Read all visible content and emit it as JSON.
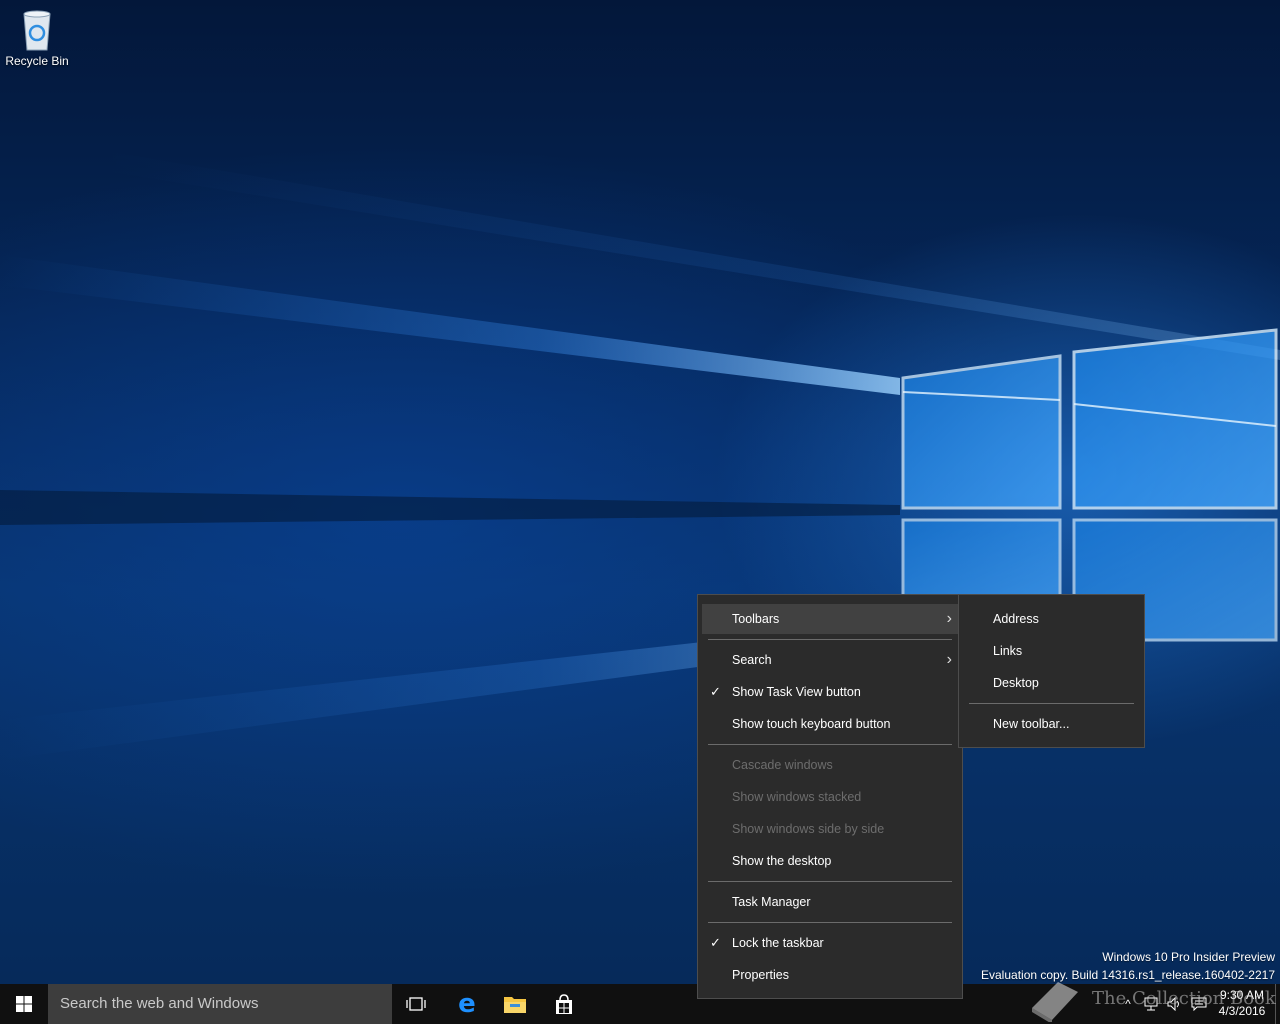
{
  "desktop": {
    "icons": [
      {
        "label": "Recycle Bin",
        "icon": "recycle-bin-icon"
      }
    ],
    "watermark": {
      "line1": "Windows 10 Pro Insider Preview",
      "line2": "Evaluation copy. Build 14316.rs1_release.160402-2217"
    },
    "overlay_logo_text": "The Collection Book"
  },
  "taskbar": {
    "start_icon": "windows-logo-icon",
    "search_placeholder": "Search the web and Windows",
    "pinned": [
      {
        "name": "Task View",
        "icon": "task-view-icon"
      },
      {
        "name": "Microsoft Edge",
        "icon": "edge-icon"
      },
      {
        "name": "File Explorer",
        "icon": "folder-icon"
      },
      {
        "name": "Store",
        "icon": "store-icon"
      }
    ],
    "tray": {
      "chevron": "^",
      "clock_time": "9:30 AM",
      "clock_date": "4/3/2016"
    }
  },
  "context_menu": {
    "items": [
      {
        "label": "Toolbars",
        "has_submenu": true,
        "highlighted": true
      },
      {
        "label": "Search",
        "has_submenu": true
      },
      {
        "label": "Show Task View button",
        "checked": true
      },
      {
        "label": "Show touch keyboard button"
      },
      {
        "label": "Cascade windows",
        "disabled": true
      },
      {
        "label": "Show windows stacked",
        "disabled": true
      },
      {
        "label": "Show windows side by side",
        "disabled": true
      },
      {
        "label": "Show the desktop"
      },
      {
        "label": "Task Manager"
      },
      {
        "label": "Lock the taskbar",
        "checked": true
      },
      {
        "label": "Properties"
      }
    ],
    "check_glyph": "✓",
    "arrow_glyph": "›"
  },
  "toolbars_submenu": {
    "items": [
      {
        "label": "Address"
      },
      {
        "label": "Links"
      },
      {
        "label": "Desktop"
      },
      {
        "label": "New toolbar..."
      }
    ]
  },
  "colors": {
    "menu_bg": "#2b2b2b",
    "menu_hover": "#414141",
    "taskbar": "#101010",
    "accent": "#0078d7"
  }
}
